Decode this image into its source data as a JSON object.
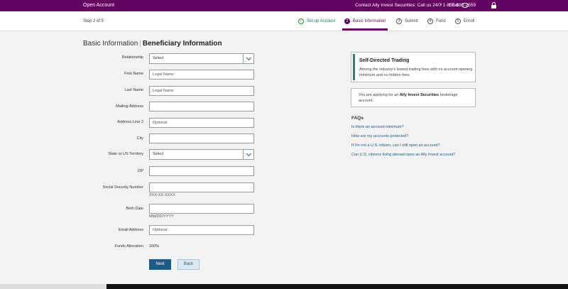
{
  "topbar": {
    "title": "Open Account",
    "contact": "Contact Ally Invest Securities:   Call us 24/7 1-855-880-2559",
    "separator": "•",
    "chat": "Chat"
  },
  "stepbar": {
    "counter": "Step 2 of 5",
    "steps": [
      {
        "num": "✓",
        "label": "Set up Account"
      },
      {
        "num": "2",
        "label": "Basic Information"
      },
      {
        "num": "3",
        "label": "Submit"
      },
      {
        "num": "4",
        "label": "Fund"
      },
      {
        "num": "5",
        "label": "Enroll"
      }
    ]
  },
  "heading": {
    "section": "Basic Information",
    "subsection": "Beneficiary Information"
  },
  "form": {
    "relationship": {
      "label": "Relationship",
      "value": "Select"
    },
    "first_name": {
      "label": "First Name",
      "placeholder": "Legal Name"
    },
    "last_name": {
      "label": "Last Name",
      "placeholder": "Legal Name"
    },
    "mailing_address": {
      "label": "Mailing Address",
      "placeholder": ""
    },
    "address_line2": {
      "label": "Address Line 2",
      "placeholder": "Optional"
    },
    "city": {
      "label": "City",
      "placeholder": ""
    },
    "state": {
      "label": "State or US Territory",
      "value": "Select"
    },
    "zip": {
      "label": "ZIP",
      "placeholder": ""
    },
    "ssn": {
      "label": "Social Security Number",
      "placeholder": "",
      "hint": "XXX-XX-XXXX"
    },
    "birth_date": {
      "label": "Birth Date",
      "placeholder": "",
      "hint": "MM/DD/YYYY"
    },
    "email": {
      "label": "Email Address",
      "placeholder": "Optional"
    },
    "funds_allocation": {
      "label": "Funds Allocation",
      "value": "100%"
    }
  },
  "buttons": {
    "next": "Next",
    "back": "Back"
  },
  "sidebar": {
    "promo_title": "Self-Directed Trading",
    "promo_text": "Among the industry's lowest trading fees with no account opening minimum and no hidden fees.",
    "applying_pre": "You are applying for an ",
    "applying_bold": "Ally Invest Securities",
    "applying_post": " brokerage account.",
    "faqs_title": "FAQs",
    "faqs": [
      "Is there an account minimum?",
      "How are my accounts protected?",
      "If I'm not a U.S. citizen, can I still open an account?",
      "Can U.S. citizens living abroad open an Ally Invest account?"
    ]
  },
  "colors": {
    "brand": "#650360",
    "primary_button": "#1a5c85",
    "accent_bar": "#0f8a80"
  }
}
